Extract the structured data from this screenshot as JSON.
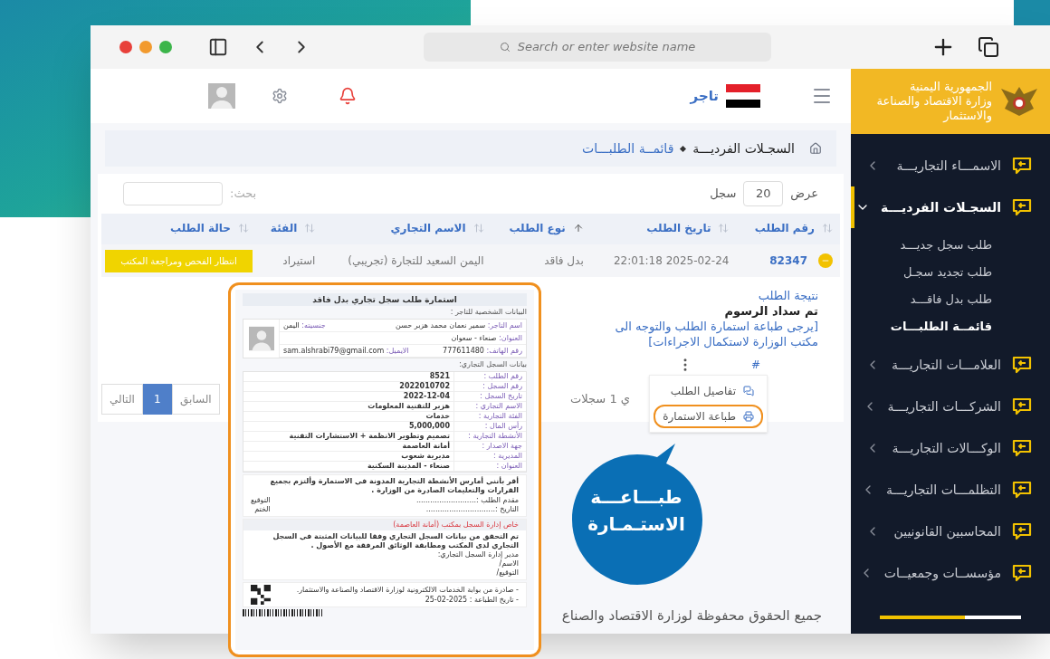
{
  "browser": {
    "address_placeholder": "Search or enter website name"
  },
  "header": {
    "user_type": "تاجر",
    "logo_lines": [
      "الجمهورية اليمنية",
      "وزارة الاقتصاد والصناعة",
      "والاستثمار"
    ]
  },
  "sidebar": {
    "items": [
      {
        "label": "الاسمـــاء التجاريـــة",
        "expanded": false
      },
      {
        "label": "السجـلات الفرديـــة",
        "expanded": true,
        "children": [
          {
            "label": "طلب سجل جديـــد",
            "selected": false
          },
          {
            "label": "طلب تجديد سجـل",
            "selected": false
          },
          {
            "label": "طلب بدل فاقـــد",
            "selected": false
          },
          {
            "label": "قائمــة الطلبـــات",
            "selected": true
          }
        ]
      },
      {
        "label": "العلامـــات التجاريـــة",
        "expanded": false
      },
      {
        "label": "الشركـــات التجاريـــة",
        "expanded": false
      },
      {
        "label": "الوكـــالات التجاريـــة",
        "expanded": false
      },
      {
        "label": "التظلمـــات التجاريـــة",
        "expanded": false
      },
      {
        "label": "المحاسبين القانونيين",
        "expanded": false
      },
      {
        "label": "مؤسســات وجمعيــات",
        "expanded": false
      }
    ]
  },
  "breadcrumb": [
    "السجـلات الفرديـــة",
    "قائمــة الطلبـــات"
  ],
  "table": {
    "show_label": "عرض",
    "page_size": "20",
    "records_label": "سجل",
    "search_label": "بحث:",
    "columns": [
      {
        "label": "رقم الطلب",
        "sorted": false
      },
      {
        "label": "تاريخ الطلب",
        "sorted": false
      },
      {
        "label": "نوع الطلب",
        "sorted": true
      },
      {
        "label": "الاسم التجاري",
        "sorted": false
      },
      {
        "label": "الفئة",
        "sorted": false
      },
      {
        "label": "حالة الطلب",
        "sorted": false
      }
    ],
    "rows": [
      {
        "expanded": true,
        "cells": [
          "82347",
          "2025-02-24 22:01:18",
          "بدل فاقد",
          "اليمن السعيد للتجارة (تجريبي)",
          "استيراد"
        ],
        "status": "انتظار الفحص ومراجعة المكتب",
        "detail": {
          "result_label": "نتيجة الطلب",
          "result": "تم سداد الرسوم",
          "note": "[يرجى طباعة استمارة الطلب والتوجه الى مكتب الوزارة لاستكمال الاجراءات]",
          "hash": "#",
          "menu": [
            {
              "label": "تفاصيل الطلب",
              "kind": "details",
              "highlighted": false
            },
            {
              "label": "طباعة الاستمارة",
              "kind": "print",
              "highlighted": true
            }
          ]
        }
      }
    ],
    "info": "ي 1 سجلات"
  },
  "pagination": {
    "prev": "السابق",
    "pages": [
      {
        "label": "1",
        "selected": true
      }
    ],
    "next": "التالي"
  },
  "footer": "جميع الحقوق محفوظة لوزارة الاقتصاد والصناع",
  "preview": {
    "title": "استمارة طلب سجل تجاري بدل فاقد",
    "personal_heading": "البيانات الشخصية للتاجر :",
    "personal_rows": [
      [
        {
          "label": "اسم التاجر:",
          "value": "سمير نعمان محمد هزبر حسن"
        },
        {
          "label": "جنسيته:",
          "value": "اليمن"
        }
      ],
      [
        {
          "label": "العنوان:",
          "value": "صنعاء - سعوان"
        }
      ],
      [
        {
          "label": "رقم الهاتف:",
          "value": "777611480"
        },
        {
          "label": "الايميل:",
          "value": "sam.alshrabi79@gmail.com"
        }
      ]
    ],
    "record_heading": "بيانات السجل التجاري:",
    "record_rows": [
      {
        "label": "رقم الطلب :",
        "value": "8521"
      },
      {
        "label": "رقم السجل :",
        "value": "2022010702"
      },
      {
        "label": "تاريخ السجل :",
        "value": "2022-12-04"
      },
      {
        "label": "الاسم التجاري :",
        "value": "هزبر للتقنية المعلومات"
      },
      {
        "label": "الفئة التجارية :",
        "value": "خدمات"
      },
      {
        "label": "رأس المال :",
        "value": "5,000,000"
      },
      {
        "label": "الأنشطة التجارية :",
        "value": "تصميم وتطوير الانظمة + الاستشارات التقنية"
      },
      {
        "label": "جهة الاصدار :",
        "value": "أمانة العاصمة"
      },
      {
        "label": "المديرية :",
        "value": "مديرية شعوب"
      },
      {
        "label": "العنوان :",
        "value": "صنعاء - المدينة السكنية"
      }
    ],
    "declaration": "أقر بأنني أمارس الأنشطة التجارية المدونة في الاستمارة وألتزم بجميع القرارات والتعليمات الصادرة من الوزارة .",
    "applicant_fields": [
      "مقدم الطلب :..........................",
      "التاريخ :.............................."
    ],
    "stamp_fields": [
      "التوقيع",
      "الختم"
    ],
    "office_heading": "خاص إدارة السجل بمكتب (أمانة العاصمة)",
    "office_text": "تم التحقق من بيانات السجل التجاري وفقا للبيانات المثبتة في السجل التجاري لدى المكتب ومطابقة الوثائق المرفقة مع الأصول .",
    "office_fields": [
      "مدير إدارة السجل التجاري:",
      "الاسم/",
      "التوقيع/"
    ],
    "footer_lines": [
      "- صادرة من بوابة الخدمات الالكترونية لوزارة الاقتصاد والصناعة والاستثمار.",
      "- تاريخ الطباعة : 2025-02-25"
    ]
  },
  "callout": [
    "طبـــاعـــة",
    "الاستـمـارة"
  ]
}
